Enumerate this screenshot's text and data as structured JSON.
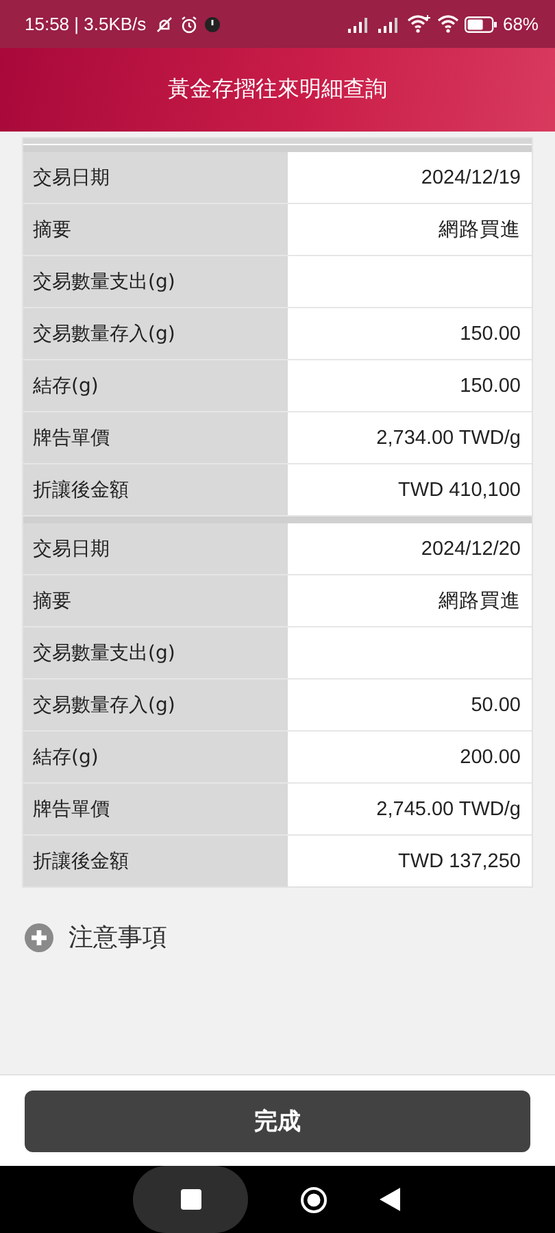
{
  "status_bar": {
    "time": "15:58 | 3.5KB/s",
    "battery": "68%"
  },
  "header": {
    "title": "黃金存摺往來明細查詢"
  },
  "records": [
    {
      "rows": [
        {
          "label": "交易日期",
          "value": "2024/12/19"
        },
        {
          "label": "摘要",
          "value": "網路買進"
        },
        {
          "label": "交易數量支出(g)"
        },
        {
          "label": "交易數量存入(g)",
          "value": "150.00"
        },
        {
          "label": "結存(g)",
          "value": "150.00"
        },
        {
          "label": "牌告單價",
          "value": "2,734.00 TWD/g"
        },
        {
          "label": "折讓後金額",
          "value": "TWD 410,100"
        }
      ]
    },
    {
      "rows": [
        {
          "label": "交易日期",
          "value": "2024/12/20"
        },
        {
          "label": "摘要",
          "value": "網路買進"
        },
        {
          "label": "交易數量支出(g)"
        },
        {
          "label": "交易數量存入(g)",
          "value": "50.00"
        },
        {
          "label": "結存(g)",
          "value": "200.00"
        },
        {
          "label": "牌告單價",
          "value": "2,745.00 TWD/g"
        },
        {
          "label": "折讓後金額",
          "value": "TWD 137,250"
        }
      ]
    }
  ],
  "notice": {
    "label": "注意事項",
    "expanded": false
  },
  "footer": {
    "button": "完成"
  }
}
